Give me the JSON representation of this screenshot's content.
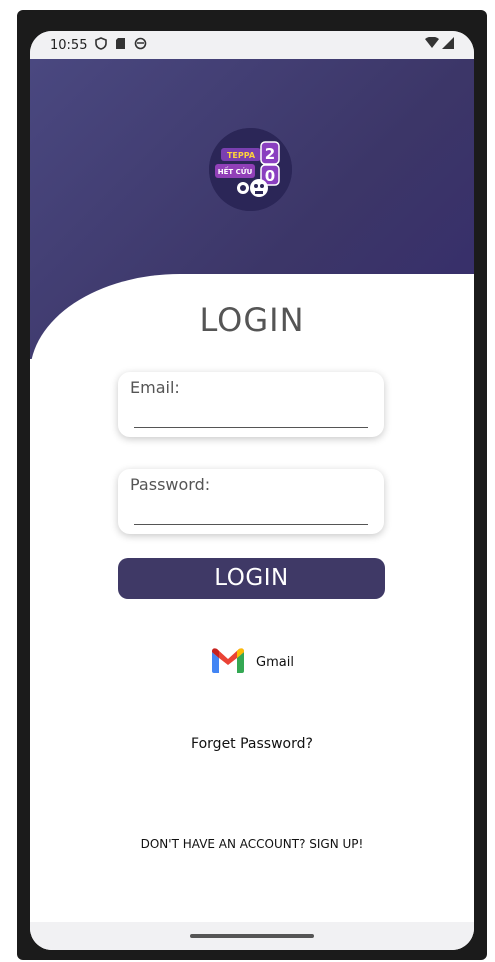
{
  "status_bar": {
    "time": "10:55"
  },
  "logo": {
    "line1": "TEPPA",
    "line2": "HẾT CỨU",
    "digits": [
      "2",
      "0"
    ]
  },
  "login": {
    "title": "LOGIN",
    "email": {
      "label": "Email:",
      "value": ""
    },
    "password": {
      "label": "Password:",
      "value": ""
    },
    "button_label": "LOGIN",
    "gmail_label": "Gmail",
    "forget_password": "Forget Password?",
    "signup": "DON'T HAVE AN ACCOUNT? SIGN UP!"
  },
  "colors": {
    "header_gradient_start": "#4a4880",
    "header_gradient_end": "#362d6b",
    "button_bg": "#3f3966"
  }
}
